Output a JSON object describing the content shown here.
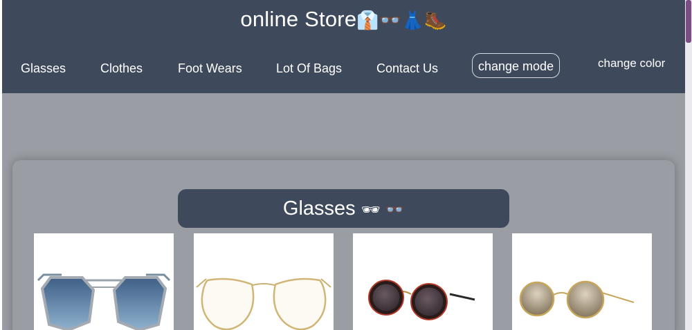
{
  "header": {
    "title": "online Store",
    "title_emoji": "👔👓👗🥾"
  },
  "nav": {
    "items": [
      {
        "label": "Glasses"
      },
      {
        "label": "Clothes"
      },
      {
        "label": "Foot Wears"
      },
      {
        "label": "Lot Of Bags"
      },
      {
        "label": "Contact Us"
      }
    ],
    "mode_button": "change mode",
    "color_link": "change color"
  },
  "section": {
    "title": "Glasses",
    "title_emoji": "🕶 👓"
  },
  "products": [
    {
      "icon": "hexagonal-sunglasses-icon"
    },
    {
      "icon": "aviator-eyeglasses-icon"
    },
    {
      "icon": "round-red-sunglasses-icon"
    },
    {
      "icon": "round-gold-sunglasses-icon"
    }
  ],
  "colors": {
    "header": "#3e4a5c",
    "page": "#9a9ea4",
    "scrollbar_thumb": "#7b4d84"
  }
}
